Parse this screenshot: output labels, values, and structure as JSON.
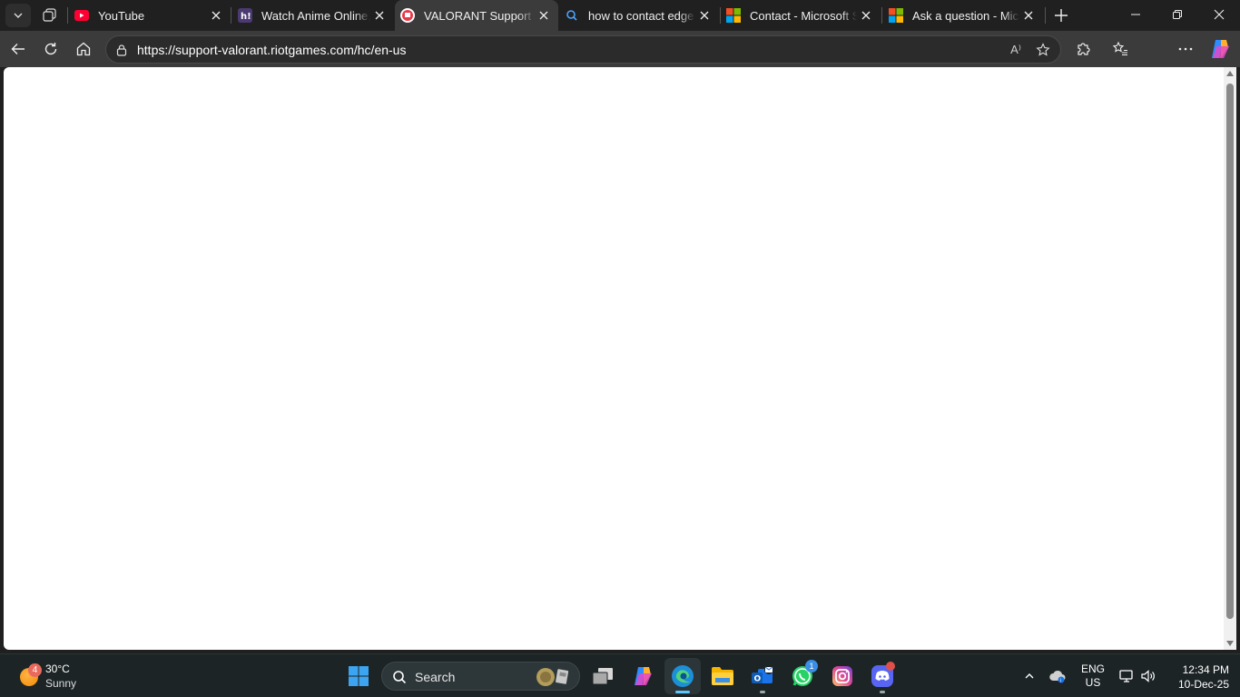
{
  "browser": {
    "tabs": [
      {
        "title": "YouTube",
        "favicon": "youtube-icon",
        "active": false
      },
      {
        "title": "Watch Anime Online, F",
        "favicon": "hianime-icon",
        "active": false
      },
      {
        "title": "VALORANT Support",
        "favicon": "riot-icon",
        "active": true
      },
      {
        "title": "how to contact edge s",
        "favicon": "search-icon",
        "active": false
      },
      {
        "title": "Contact - Microsoft Su",
        "favicon": "microsoft-icon",
        "active": false
      },
      {
        "title": "Ask a question - Micro",
        "favicon": "microsoft-icon",
        "active": false
      }
    ],
    "url": "https://support-valorant.riotgames.com/hc/en-us",
    "read_aloud_label": "A⁾",
    "favicon_colors": {
      "youtube": "#ff0033",
      "riot": "#e8394b",
      "hianime": "#5a3d8a"
    }
  },
  "taskbar": {
    "weather": {
      "badge": "4",
      "temp": "30°C",
      "condition": "Sunny"
    },
    "search_label": "Search",
    "apps": [
      {
        "name": "start-button",
        "icon": "windows-logo-icon"
      },
      {
        "name": "task-view-button",
        "icon": "task-view-icon"
      },
      {
        "name": "copilot-app",
        "icon": "copilot-icon"
      },
      {
        "name": "edge-app",
        "icon": "edge-icon",
        "active": true
      },
      {
        "name": "file-explorer-app",
        "icon": "folder-icon"
      },
      {
        "name": "outlook-app",
        "icon": "outlook-icon"
      },
      {
        "name": "whatsapp-app",
        "icon": "whatsapp-icon",
        "badge": "1"
      },
      {
        "name": "instagram-app",
        "icon": "instagram-icon"
      },
      {
        "name": "discord-app",
        "icon": "discord-icon"
      }
    ],
    "lang": {
      "line1": "ENG",
      "line2": "US"
    },
    "clock": {
      "time": "12:34 PM",
      "date": "10-Dec-25"
    }
  }
}
